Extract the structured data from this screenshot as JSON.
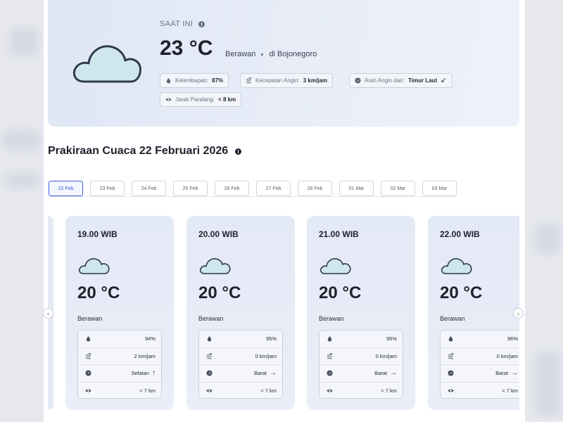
{
  "current": {
    "label": "SAAT INI",
    "temperature": "23 °C",
    "condition": "Berawan",
    "location": "di Bojonegoro",
    "chips": [
      {
        "icon": "droplet-icon",
        "label": "Kelembapan:",
        "value": "87%"
      },
      {
        "icon": "wind-icon",
        "label": "Kecepatan Angin:",
        "value": "3 km/jam"
      },
      {
        "icon": "compass-icon",
        "label": "Arah Angin dari:",
        "value": "Timur Laut",
        "arrow": "↙"
      },
      {
        "icon": "eye-icon",
        "label": "Jarak Pandang:",
        "value": "< 8 km"
      }
    ]
  },
  "forecast": {
    "title": "Prakiraan Cuaca 22 Februari 2026",
    "dates": [
      "22 Feb",
      "23 Feb",
      "24 Feb",
      "25 Feb",
      "26 Feb",
      "27 Feb",
      "28 Feb",
      "01 Mar",
      "02 Mar",
      "03 Mar"
    ],
    "active_date": "22 Feb",
    "hours": [
      {
        "time": "19.00 WIB",
        "temp": "20 °C",
        "condition": "Berawan",
        "humidity": "94%",
        "wind_speed": "2 km/jam",
        "wind_dir": "Selatan",
        "wind_arrow": "↑",
        "visibility": "< 7 km"
      },
      {
        "time": "20.00 WIB",
        "temp": "20 °C",
        "condition": "Berawan",
        "humidity": "95%",
        "wind_speed": "0 km/jam",
        "wind_dir": "Barat",
        "wind_arrow": "→",
        "visibility": "< 7 km"
      },
      {
        "time": "21.00 WIB",
        "temp": "20 °C",
        "condition": "Berawan",
        "humidity": "95%",
        "wind_speed": "0 km/jam",
        "wind_dir": "Barat",
        "wind_arrow": "→",
        "visibility": "< 7 km"
      },
      {
        "time": "22.00 WIB",
        "temp": "20 °C",
        "condition": "Berawan",
        "humidity": "96%",
        "wind_speed": "0 km/jam",
        "wind_dir": "Barat",
        "wind_arrow": "→",
        "visibility": "< 7 km"
      }
    ]
  },
  "nav": {
    "prev": "‹",
    "next": "›"
  },
  "colors": {
    "accent": "#3b5bd6",
    "card_bg": "#e4e9f6",
    "cloud_fill": "#cfe6ec",
    "cloud_stroke": "#2e3a4d"
  }
}
